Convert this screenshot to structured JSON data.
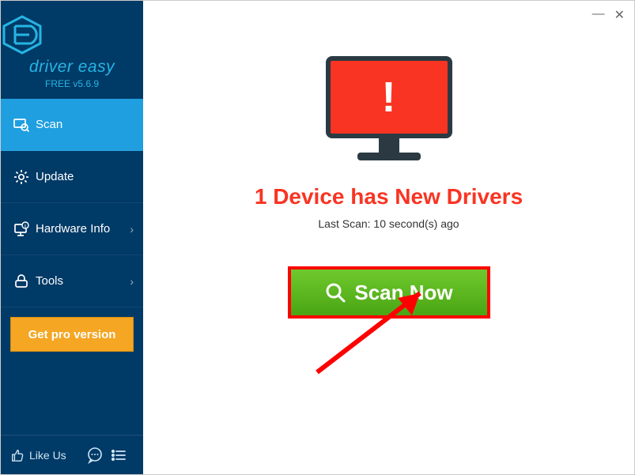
{
  "brand": {
    "name": "driver easy",
    "version_label": "FREE v5.6.9"
  },
  "sidebar": {
    "items": [
      {
        "label": "Scan",
        "icon": "scan-icon",
        "active": true,
        "chevron": false
      },
      {
        "label": "Update",
        "icon": "gear-icon",
        "active": false,
        "chevron": false
      },
      {
        "label": "Hardware Info",
        "icon": "hardware-icon",
        "active": false,
        "chevron": true
      },
      {
        "label": "Tools",
        "icon": "tools-icon",
        "active": false,
        "chevron": true
      }
    ],
    "pro_button": "Get pro version",
    "like_label": "Like Us"
  },
  "main": {
    "alert_glyph": "!",
    "headline": "1 Device has New Drivers",
    "last_scan": "Last Scan: 10 second(s) ago",
    "scan_button": "Scan Now"
  },
  "window": {
    "minimize": "—",
    "close": "✕"
  }
}
